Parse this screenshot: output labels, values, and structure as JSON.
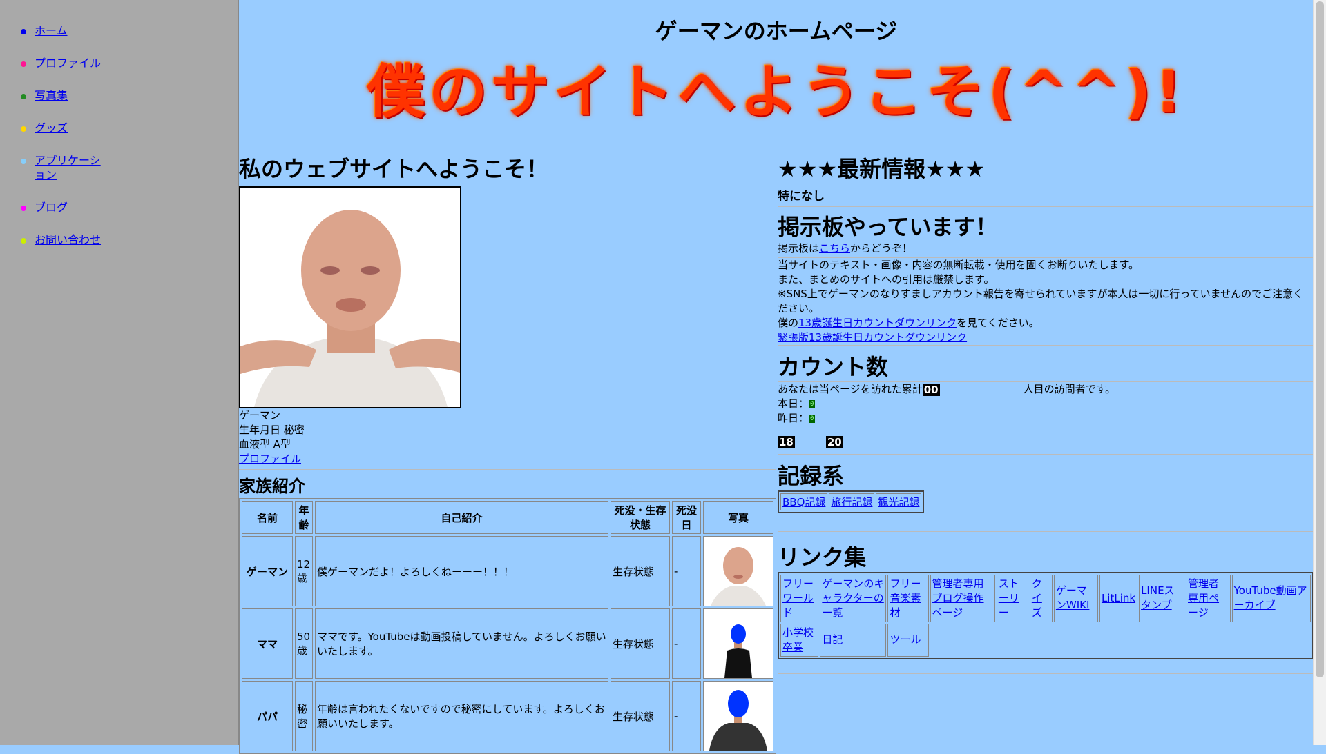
{
  "sidebar": {
    "items": [
      {
        "label": "ホーム",
        "color": "#0000ee"
      },
      {
        "label": "プロファイル",
        "color": "#ff1493"
      },
      {
        "label": "写真集",
        "color": "#228b22"
      },
      {
        "label": "グッズ",
        "color": "#ffd700"
      },
      {
        "label": "アプリケーション",
        "color": "#87cefa"
      },
      {
        "label": "ブログ",
        "color": "#ff00ff"
      },
      {
        "label": "お問い合わせ",
        "color": "#ccee00"
      }
    ]
  },
  "header": {
    "title": "ゲーマンのホームページ",
    "banner": "僕のサイトへようこそ(^^)!"
  },
  "left": {
    "welcome_heading": "私のウェブサイトへようこそ！",
    "name": "ゲーマン",
    "birthday": "生年月日 秘密",
    "blood": "血液型 A型",
    "profile_link": "プロファイル",
    "family_heading": "家族紹介",
    "family_table": {
      "headers": [
        "名前",
        "年齢",
        "自己紹介",
        "死没・生存状態",
        "死没日",
        "写真"
      ],
      "rows": [
        {
          "name": "ゲーマン",
          "age": "12歳",
          "intro": "僕ゲーマンだよ！よろしくねーーー！！！",
          "status": "生存状態",
          "death": "-"
        },
        {
          "name": "ママ",
          "age": "50歳",
          "intro": "ママです。YouTubeは動画投稿していません。よろしくお願いいたします。",
          "status": "生存状態",
          "death": "-"
        },
        {
          "name": "パパ",
          "age": "秘密",
          "intro": "年齢は言われたくないですので秘密にしています。よろしくお願いいたします。",
          "status": "生存状態",
          "death": "-"
        }
      ]
    }
  },
  "right": {
    "news_heading": "★★★最新情報★★★",
    "news_text": "特になし",
    "bbs_heading": "掲示板やっています！",
    "bbs_pre": "掲示板は",
    "bbs_link": "こちら",
    "bbs_post": "からどうぞ！",
    "notice1": "当サイトのテキスト・画像・内容の無断転載・使用を固くお断りいたします。",
    "notice2": "また、まとめのサイトへの引用は厳禁します。",
    "notice3": "※SNS上でゲーマンのなりすましアカウント報告を寄せられていますが本人は一切に行っていませんのでご注意ください。",
    "countdown_pre": "僕の",
    "countdown_link": "13歳誕生日カウントダウンリンク",
    "countdown_post": "を見てください。",
    "tense_link": "緊張版13歳誕生日カウントダウンリンク",
    "count_heading": "カウント数",
    "visitor_pre": "あなたは当ページを訪れた累計",
    "visitor_digits": "00",
    "visitor_post": "人目の訪問者です。",
    "today_label": "本日：",
    "today_value": "0",
    "yesterday_label": "昨日：",
    "yesterday_value": "0",
    "counter_a": "18",
    "counter_b": "20",
    "records_heading": "記録系",
    "records": [
      "BBQ記録",
      "旅行記録",
      "観光記録"
    ],
    "links_heading": "リンク集",
    "links_row1": [
      "フリーワールド",
      "ゲーマンのキャラクターの一覧",
      "フリー音楽素材",
      "管理者専用ブログ操作ページ",
      "ストーリー",
      "クイズ",
      "ゲーマンWIKI",
      "LitLink",
      "LINEスタンプ",
      "管理者専用ページ",
      "YouTube動画アーカイブ"
    ],
    "links_row2": [
      "小学校卒業",
      "日記",
      "ツール"
    ]
  }
}
